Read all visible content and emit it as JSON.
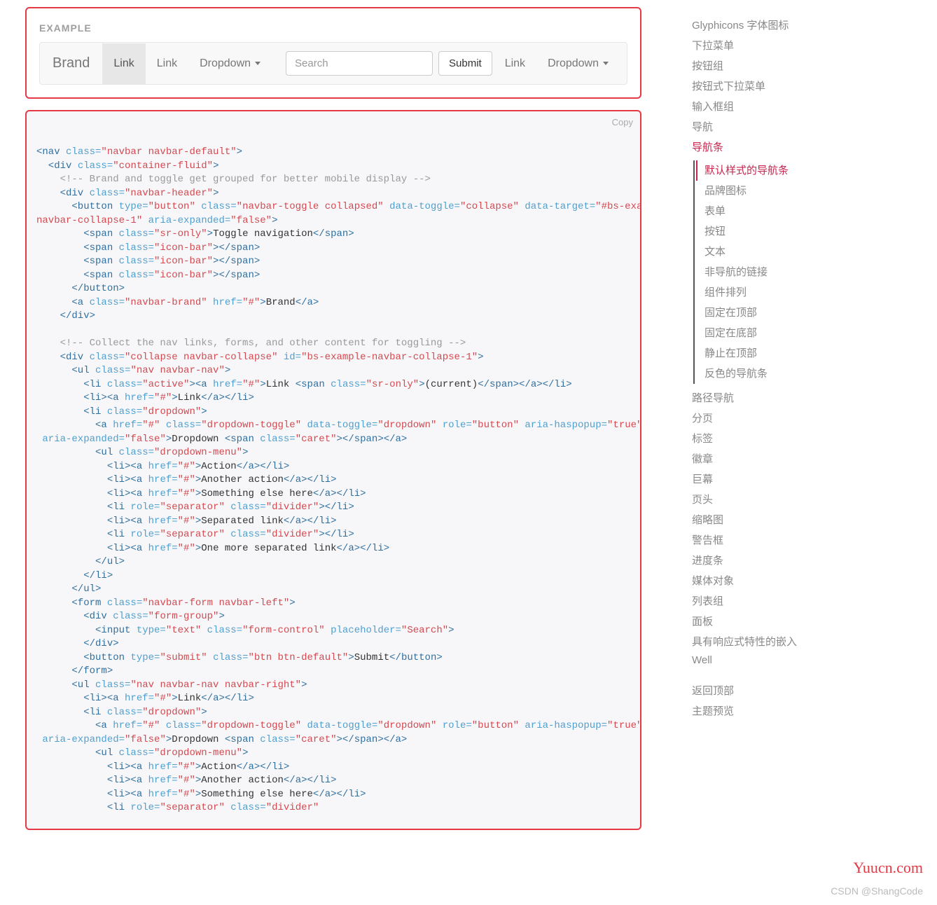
{
  "example": {
    "label": "EXAMPLE",
    "brand": "Brand",
    "link1": "Link",
    "link2": "Link",
    "dropdown1": "Dropdown",
    "searchPlaceholder": "Search",
    "submit": "Submit",
    "linkR": "Link",
    "dropdownR": "Dropdown"
  },
  "code": {
    "copy": "Copy",
    "l1a": "<nav",
    "l1b": " class=",
    "l1c": "\"navbar navbar-default\"",
    "l1d": ">",
    "l2a": "  <div",
    "l2b": " class=",
    "l2c": "\"container-fluid\"",
    "l2d": ">",
    "l3": "    <!-- Brand and toggle get grouped for better mobile display -->",
    "l4a": "    <div",
    "l4b": " class=",
    "l4c": "\"navbar-header\"",
    "l4d": ">",
    "l5a": "      <button",
    "l5b": " type=",
    "l5c": "\"button\"",
    "l5d": " class=",
    "l5e": "\"navbar-toggle collapsed\"",
    "l5f": " data-toggle=",
    "l5g": "\"collapse\"",
    "l5h": " data-target=",
    "l5i": "\"#bs-example-",
    "l5j": "navbar-collapse-1\"",
    "l5k": " aria-expanded=",
    "l5l": "\"false\"",
    "l5m": ">",
    "l6a": "        <span",
    "l6b": " class=",
    "l6c": "\"sr-only\"",
    "l6d": ">",
    "l6e": "Toggle navigation",
    "l6f": "</span>",
    "l7a": "        <span",
    "l7b": " class=",
    "l7c": "\"icon-bar\"",
    "l7d": "></span>",
    "l8a": "      </button>",
    "l9a": "      <a",
    "l9b": " class=",
    "l9c": "\"navbar-brand\"",
    "l9d": " href=",
    "l9e": "\"#\"",
    "l9f": ">",
    "l9g": "Brand",
    "l9h": "</a>",
    "l10": "    </div>",
    "blank": " ",
    "l11": "    <!-- Collect the nav links, forms, and other content for toggling -->",
    "l12a": "    <div",
    "l12b": " class=",
    "l12c": "\"collapse navbar-collapse\"",
    "l12d": " id=",
    "l12e": "\"bs-example-navbar-collapse-1\"",
    "l12f": ">",
    "l13a": "      <ul",
    "l13b": " class=",
    "l13c": "\"nav navbar-nav\"",
    "l13d": ">",
    "l14a": "        <li",
    "l14b": " class=",
    "l14c": "\"active\"",
    "l14d": "><a",
    "l14e": " href=",
    "l14f": "\"#\"",
    "l14g": ">",
    "l14h": "Link ",
    "l14i": "<span",
    "l14j": " class=",
    "l14k": "\"sr-only\"",
    "l14l": ">",
    "l14m": "(current)",
    "l14n": "</span></a></li>",
    "l15a": "        <li><a",
    "l15b": " href=",
    "l15c": "\"#\"",
    "l15d": ">",
    "l15e": "Link",
    "l15f": "</a></li>",
    "l16a": "        <li",
    "l16b": " class=",
    "l16c": "\"dropdown\"",
    "l16d": ">",
    "l17a": "          <a",
    "l17b": " href=",
    "l17c": "\"#\"",
    "l17d": " class=",
    "l17e": "\"dropdown-toggle\"",
    "l17f": " data-toggle=",
    "l17g": "\"dropdown\"",
    "l17h": " role=",
    "l17i": "\"button\"",
    "l17j": " aria-haspopup=",
    "l17k": "\"true\"",
    "l18a": " aria-expanded=",
    "l18b": "\"false\"",
    "l18c": ">",
    "l18d": "Dropdown ",
    "l18e": "<span",
    "l18f": " class=",
    "l18g": "\"caret\"",
    "l18h": "></span></a>",
    "l19a": "          <ul",
    "l19b": " class=",
    "l19c": "\"dropdown-menu\"",
    "l19d": ">",
    "l20a": "            <li><a",
    "l20b": " href=",
    "l20c": "\"#\"",
    "l20d": ">",
    "l20e": "Action",
    "l20f": "</a></li>",
    "l21e": "Another action",
    "l22e": "Something else here",
    "l23a": "            <li",
    "l23b": " role=",
    "l23c": "\"separator\"",
    "l23d": " class=",
    "l23e": "\"divider\"",
    "l23f": "></li>",
    "l24e": "Separated link",
    "l25e": "One more separated link",
    "l26": "          </ul>",
    "l27": "        </li>",
    "l28": "      </ul>",
    "l29a": "      <form",
    "l29b": " class=",
    "l29c": "\"navbar-form navbar-left\"",
    "l29d": ">",
    "l30a": "        <div",
    "l30b": " class=",
    "l30c": "\"form-group\"",
    "l30d": ">",
    "l31a": "          <input",
    "l31b": " type=",
    "l31c": "\"text\"",
    "l31d": " class=",
    "l31e": "\"form-control\"",
    "l31f": " placeholder=",
    "l31g": "\"Search\"",
    "l31h": ">",
    "l32": "        </div>",
    "l33a": "        <button",
    "l33b": " type=",
    "l33c": "\"submit\"",
    "l33d": " class=",
    "l33e": "\"btn btn-default\"",
    "l33f": ">",
    "l33g": "Submit",
    "l33h": "</button>",
    "l34": "      </form>",
    "l35a": "      <ul",
    "l35b": " class=",
    "l35c": "\"nav navbar-nav navbar-right\"",
    "l35d": ">",
    "l36a": "        <li><a",
    "l36b": " href=",
    "l36c": "\"#\"",
    "l36d": ">",
    "l36e": "Link",
    "l36f": "</a></li>",
    "l37a": "        <li",
    "l37b": " class=",
    "l37c": "\"dropdown\"",
    "l37d": ">",
    "l38a": "          <a",
    "l38b": " href=",
    "l38c": "\"#\"",
    "l38d": " class=",
    "l38e": "\"dropdown-toggle\"",
    "l38f": " data-toggle=",
    "l38g": "\"dropdown\"",
    "l38h": " role=",
    "l38i": "\"button\"",
    "l38j": " aria-haspopup=",
    "l38k": "\"true\"",
    "l39a": " aria-expanded=",
    "l39b": "\"false\"",
    "l39c": ">",
    "l39d": "Dropdown ",
    "l39e": "<span",
    "l39f": " class=",
    "l39g": "\"caret\"",
    "l39h": "></span></a>",
    "l40a": "          <ul",
    "l40b": " class=",
    "l40c": "\"dropdown-menu\"",
    "l40d": ">",
    "l41e": "Action",
    "l42e": "Another action",
    "l43e": "Something else here",
    "l44a": "            <li",
    "l44b": " role=",
    "l44c": "\"separator\"",
    "l44d": " class=",
    "l44e": "\"divider\""
  },
  "sidebar": {
    "i0": "Glyphicons 字体图标",
    "i1": "下拉菜单",
    "i2": "按钮组",
    "i3": "按钮式下拉菜单",
    "i4": "输入框组",
    "i5": "导航",
    "i6": "导航条",
    "s0": "默认样式的导航条",
    "s1": "品牌图标",
    "s2": "表单",
    "s3": "按钮",
    "s4": "文本",
    "s5": "非导航的链接",
    "s6": "组件排列",
    "s7": "固定在顶部",
    "s8": "固定在底部",
    "s9": "静止在顶部",
    "s10": "反色的导航条",
    "i7": "路径导航",
    "i8": "分页",
    "i9": "标签",
    "i10": "徽章",
    "i11": "巨幕",
    "i12": "页头",
    "i13": "缩略图",
    "i14": "警告框",
    "i15": "进度条",
    "i16": "媒体对象",
    "i17": "列表组",
    "i18": "面板",
    "i19": "具有响应式特性的嵌入",
    "i20": "Well",
    "b1": "返回顶部",
    "b2": "主题预览"
  },
  "watermarks": {
    "w1": "Yuucn.com",
    "w2": "CSDN @ShangCode"
  }
}
